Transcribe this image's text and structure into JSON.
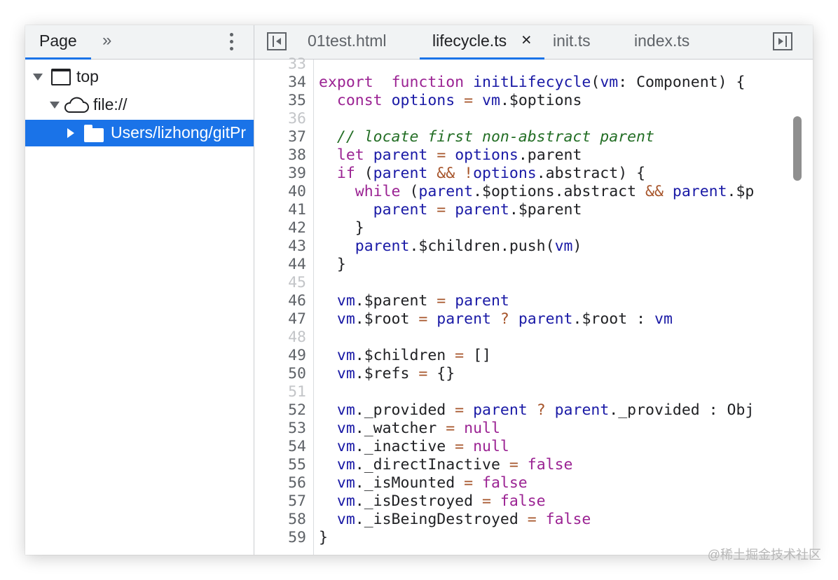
{
  "navigator": {
    "tab_label": "Page",
    "more_tabs_glyph": "»",
    "tree": [
      {
        "label": "top",
        "icon": "frame-icon"
      },
      {
        "label": "file://",
        "icon": "cloud-icon"
      },
      {
        "label": "Users/lizhong/gitPr",
        "icon": "folder-icon",
        "selected": true
      }
    ]
  },
  "editor": {
    "tabs": [
      {
        "label": "01test.html",
        "active": false
      },
      {
        "label": "lifecycle.ts",
        "active": true,
        "closable": true
      },
      {
        "label": "init.ts",
        "active": false
      },
      {
        "label": "index.ts",
        "active": false
      }
    ],
    "close_glyph": "×",
    "lines": [
      {
        "no": "33",
        "tokens": []
      },
      {
        "no": "34",
        "tokens": [
          [
            "kw",
            "export"
          ],
          [
            "",
            "  "
          ],
          [
            "kw",
            "function"
          ],
          [
            "",
            " "
          ],
          [
            "fn",
            "initLifecycle"
          ],
          [
            "",
            "("
          ],
          [
            "var",
            "vm"
          ],
          [
            "",
            ": Component) {"
          ]
        ]
      },
      {
        "no": "35",
        "tokens": [
          [
            "",
            "  "
          ],
          [
            "kw",
            "const"
          ],
          [
            "",
            " "
          ],
          [
            "var",
            "options"
          ],
          [
            "",
            " "
          ],
          [
            "op",
            "="
          ],
          [
            "",
            " "
          ],
          [
            "var",
            "vm"
          ],
          [
            "",
            ".$options"
          ]
        ]
      },
      {
        "no": "36",
        "tokens": []
      },
      {
        "no": "37",
        "tokens": [
          [
            "",
            "  "
          ],
          [
            "cm",
            "// locate first non-abstract parent"
          ]
        ]
      },
      {
        "no": "38",
        "tokens": [
          [
            "",
            "  "
          ],
          [
            "kw",
            "let"
          ],
          [
            "",
            " "
          ],
          [
            "var",
            "parent"
          ],
          [
            "",
            " "
          ],
          [
            "op",
            "="
          ],
          [
            "",
            " "
          ],
          [
            "var",
            "options"
          ],
          [
            "",
            ".parent"
          ]
        ]
      },
      {
        "no": "39",
        "tokens": [
          [
            "",
            "  "
          ],
          [
            "kw",
            "if"
          ],
          [
            "",
            " ("
          ],
          [
            "var",
            "parent"
          ],
          [
            "",
            " "
          ],
          [
            "op",
            "&&"
          ],
          [
            "",
            " "
          ],
          [
            "op",
            "!"
          ],
          [
            "var",
            "options"
          ],
          [
            "",
            ".abstract) {"
          ]
        ]
      },
      {
        "no": "40",
        "tokens": [
          [
            "",
            "    "
          ],
          [
            "kw",
            "while"
          ],
          [
            "",
            " ("
          ],
          [
            "var",
            "parent"
          ],
          [
            "",
            ".$options.abstract "
          ],
          [
            "op",
            "&&"
          ],
          [
            "",
            " "
          ],
          [
            "var",
            "parent"
          ],
          [
            "",
            ".$p"
          ]
        ]
      },
      {
        "no": "41",
        "tokens": [
          [
            "",
            "      "
          ],
          [
            "var",
            "parent"
          ],
          [
            "",
            " "
          ],
          [
            "op",
            "="
          ],
          [
            "",
            " "
          ],
          [
            "var",
            "parent"
          ],
          [
            "",
            ".$parent"
          ]
        ]
      },
      {
        "no": "42",
        "tokens": [
          [
            "",
            "    }"
          ]
        ]
      },
      {
        "no": "43",
        "tokens": [
          [
            "",
            "    "
          ],
          [
            "var",
            "parent"
          ],
          [
            "",
            ".$children.push("
          ],
          [
            "var",
            "vm"
          ],
          [
            "",
            ")"
          ]
        ]
      },
      {
        "no": "44",
        "tokens": [
          [
            "",
            "  }"
          ]
        ]
      },
      {
        "no": "45",
        "tokens": []
      },
      {
        "no": "46",
        "tokens": [
          [
            "",
            "  "
          ],
          [
            "var",
            "vm"
          ],
          [
            "",
            ".$parent "
          ],
          [
            "op",
            "="
          ],
          [
            "",
            " "
          ],
          [
            "var",
            "parent"
          ]
        ]
      },
      {
        "no": "47",
        "tokens": [
          [
            "",
            "  "
          ],
          [
            "var",
            "vm"
          ],
          [
            "",
            ".$root "
          ],
          [
            "op",
            "="
          ],
          [
            "",
            " "
          ],
          [
            "var",
            "parent"
          ],
          [
            "",
            " "
          ],
          [
            "op",
            "?"
          ],
          [
            "",
            " "
          ],
          [
            "var",
            "parent"
          ],
          [
            "",
            ".$root : "
          ],
          [
            "var",
            "vm"
          ]
        ]
      },
      {
        "no": "48",
        "tokens": []
      },
      {
        "no": "49",
        "tokens": [
          [
            "",
            "  "
          ],
          [
            "var",
            "vm"
          ],
          [
            "",
            ".$children "
          ],
          [
            "op",
            "="
          ],
          [
            "",
            " []"
          ]
        ]
      },
      {
        "no": "50",
        "tokens": [
          [
            "",
            "  "
          ],
          [
            "var",
            "vm"
          ],
          [
            "",
            ".$refs "
          ],
          [
            "op",
            "="
          ],
          [
            "",
            " {}"
          ]
        ]
      },
      {
        "no": "51",
        "tokens": []
      },
      {
        "no": "52",
        "tokens": [
          [
            "",
            "  "
          ],
          [
            "var",
            "vm"
          ],
          [
            "",
            "._provided "
          ],
          [
            "op",
            "="
          ],
          [
            "",
            " "
          ],
          [
            "var",
            "parent"
          ],
          [
            "",
            " "
          ],
          [
            "op",
            "?"
          ],
          [
            "",
            " "
          ],
          [
            "var",
            "parent"
          ],
          [
            "",
            "._provided : Obj"
          ]
        ]
      },
      {
        "no": "53",
        "tokens": [
          [
            "",
            "  "
          ],
          [
            "var",
            "vm"
          ],
          [
            "",
            "._watcher "
          ],
          [
            "op",
            "="
          ],
          [
            "",
            " "
          ],
          [
            "kw",
            "null"
          ]
        ]
      },
      {
        "no": "54",
        "tokens": [
          [
            "",
            "  "
          ],
          [
            "var",
            "vm"
          ],
          [
            "",
            "._inactive "
          ],
          [
            "op",
            "="
          ],
          [
            "",
            " "
          ],
          [
            "kw",
            "null"
          ]
        ]
      },
      {
        "no": "55",
        "tokens": [
          [
            "",
            "  "
          ],
          [
            "var",
            "vm"
          ],
          [
            "",
            "._directInactive "
          ],
          [
            "op",
            "="
          ],
          [
            "",
            " "
          ],
          [
            "kw",
            "false"
          ]
        ]
      },
      {
        "no": "56",
        "tokens": [
          [
            "",
            "  "
          ],
          [
            "var",
            "vm"
          ],
          [
            "",
            "._isMounted "
          ],
          [
            "op",
            "="
          ],
          [
            "",
            " "
          ],
          [
            "kw",
            "false"
          ]
        ]
      },
      {
        "no": "57",
        "tokens": [
          [
            "",
            "  "
          ],
          [
            "var",
            "vm"
          ],
          [
            "",
            "._isDestroyed "
          ],
          [
            "op",
            "="
          ],
          [
            "",
            " "
          ],
          [
            "kw",
            "false"
          ]
        ]
      },
      {
        "no": "58",
        "tokens": [
          [
            "",
            "  "
          ],
          [
            "var",
            "vm"
          ],
          [
            "",
            "._isBeingDestroyed "
          ],
          [
            "op",
            "="
          ],
          [
            "",
            " "
          ],
          [
            "kw",
            "false"
          ]
        ]
      },
      {
        "no": "59",
        "tokens": [
          [
            "",
            "}"
          ]
        ]
      }
    ]
  },
  "watermark": "@稀土掘金技术社区",
  "colors": {
    "accent": "#1a73e8",
    "keyword": "#9b2393",
    "identifier": "#1a1aa6",
    "operator": "#a6542a",
    "comment": "#236e25"
  }
}
